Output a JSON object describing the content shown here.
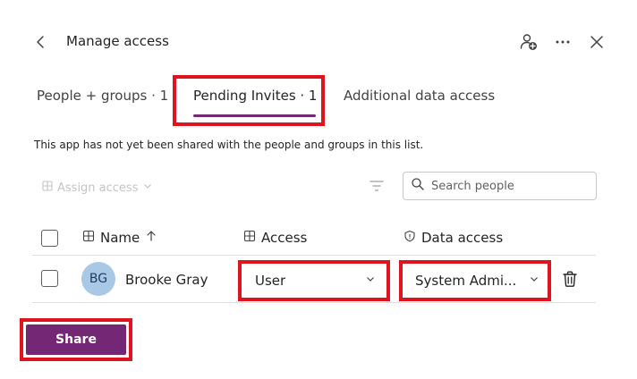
{
  "header": {
    "title": "Manage access"
  },
  "tabs": {
    "people": "People + groups · 1",
    "pending": "Pending Invites · 1",
    "additional": "Additional data access"
  },
  "info_text": "This app has not yet been shared with the people and groups in this list.",
  "toolbar": {
    "assign_access": "Assign access",
    "search_placeholder": "Search people"
  },
  "table": {
    "columns": {
      "name": "Name",
      "access": "Access",
      "data_access": "Data access"
    },
    "rows": [
      {
        "initials": "BG",
        "name": "Brooke Gray",
        "access": "User",
        "data_access": "System Admi..."
      }
    ]
  },
  "share_label": "Share",
  "colors": {
    "accent": "#742774",
    "highlight": "#e0141e",
    "avatar_bg": "#a9c8e6"
  }
}
